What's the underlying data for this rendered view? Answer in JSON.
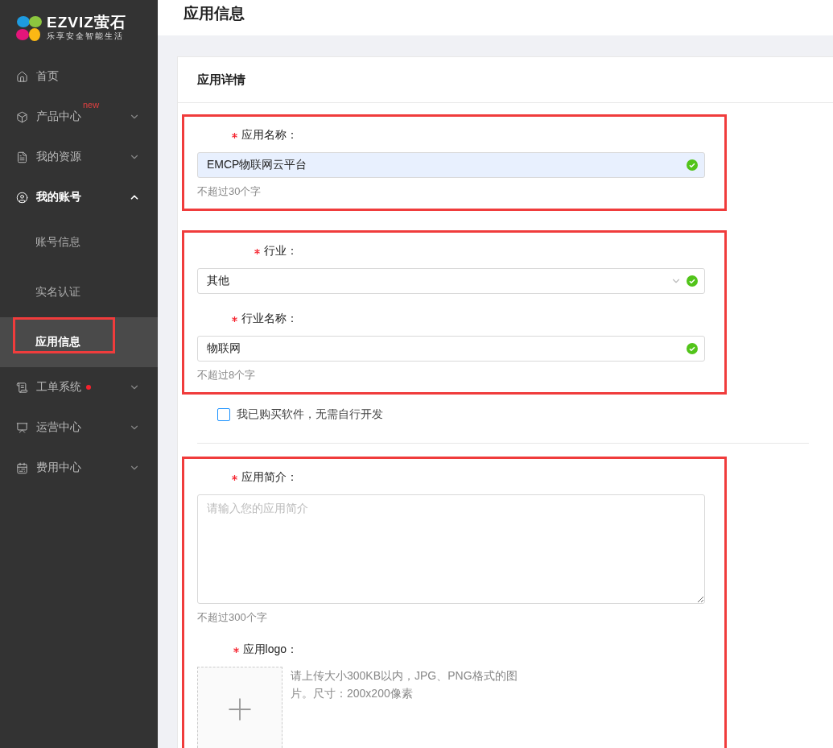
{
  "sidebar": {
    "logo": {
      "brand": "EZVIZ萤石",
      "tagline": "乐享安全智能生活"
    },
    "items": [
      {
        "label": "首页",
        "selected": false
      },
      {
        "label": "产品中心",
        "badge": "new",
        "expanded": false,
        "selected": false
      },
      {
        "label": "我的资源",
        "expanded": false,
        "selected": false
      },
      {
        "label": "我的账号",
        "expanded": true,
        "selected": false,
        "children": [
          {
            "label": "账号信息",
            "selected": false,
            "highlighted": false
          },
          {
            "label": "实名认证",
            "selected": false,
            "highlighted": false
          },
          {
            "label": "应用信息",
            "selected": true,
            "highlighted": true
          }
        ]
      },
      {
        "label": "工单系统",
        "dot": true,
        "expanded": false,
        "selected": false
      },
      {
        "label": "运营中心",
        "expanded": false,
        "selected": false
      },
      {
        "label": "费用中心",
        "expanded": false,
        "selected": false
      }
    ]
  },
  "page_title": "应用信息",
  "card": {
    "title": "应用详情",
    "sections": [
      {
        "highlighted": true,
        "fields": [
          {
            "kind": "input",
            "label": "应用名称：",
            "required": true,
            "value": "EMCP物联网云平台",
            "autofilled": true,
            "valid": true,
            "hint": "不超过30个字"
          }
        ]
      },
      {
        "highlighted": true,
        "fields": [
          {
            "kind": "select",
            "label": "行业：",
            "required": true,
            "value": "其他",
            "valid": true
          },
          {
            "kind": "input",
            "label": "行业名称：",
            "required": true,
            "value": "物联网",
            "autofilled": false,
            "valid": true,
            "hint": "不超过8个字"
          }
        ]
      },
      {
        "kind": "checkbox",
        "label": "我已购买软件，无需自行开发",
        "checked": false
      },
      {
        "kind": "divider"
      },
      {
        "highlighted": true,
        "fields": [
          {
            "kind": "textarea",
            "label": "应用简介：",
            "required": true,
            "placeholder": "请输入您的应用简介",
            "hint": "不超过300个字"
          },
          {
            "kind": "upload",
            "label": "应用logo：",
            "required": true,
            "hint": "请上传大小300KB以内，JPG、PNG格式的图片。尺寸：200x200像素"
          }
        ]
      }
    ]
  }
}
